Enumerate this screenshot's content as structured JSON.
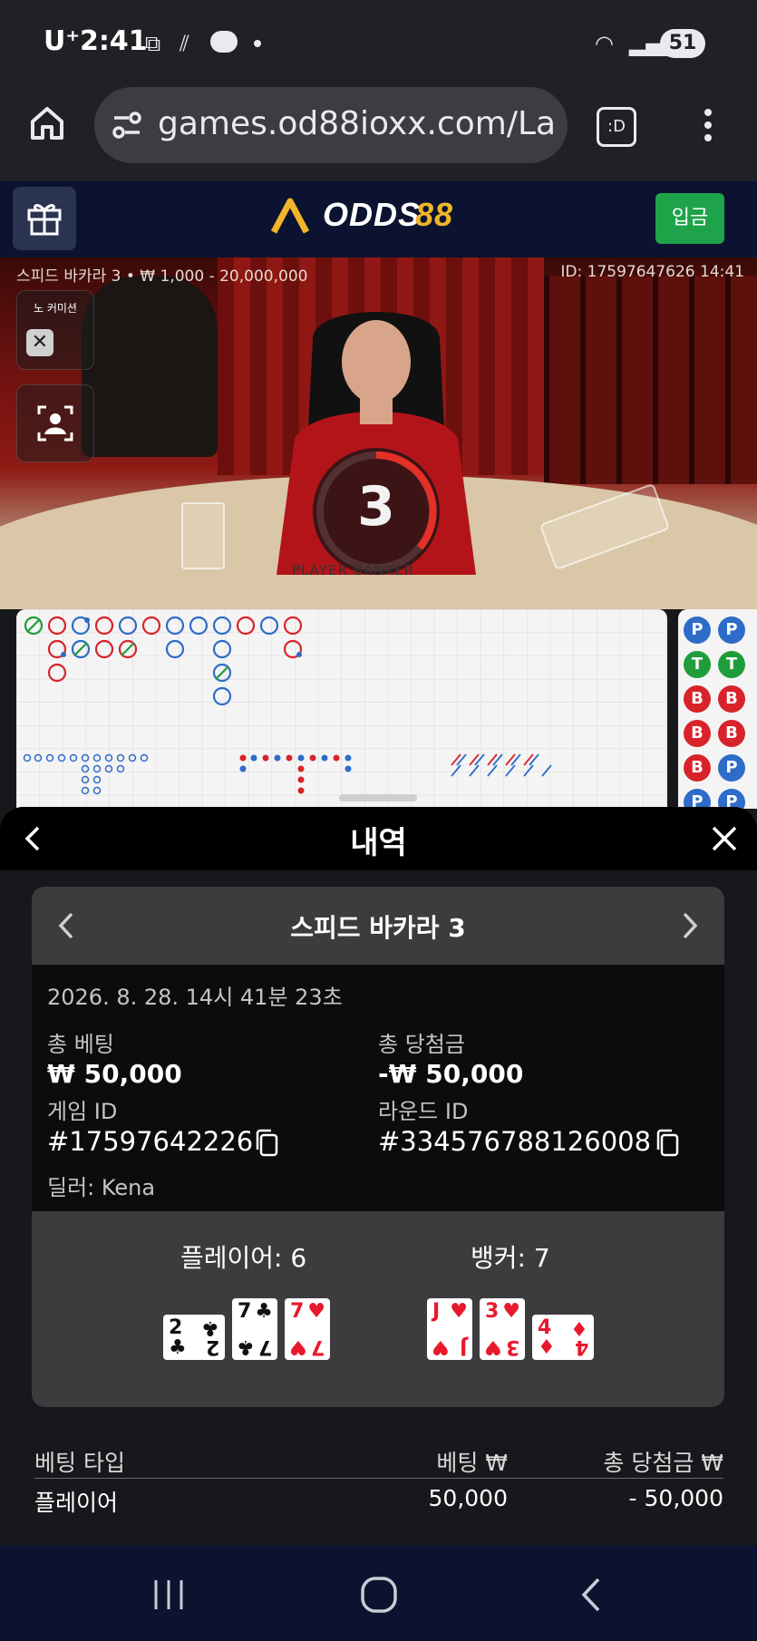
{
  "status_bar": {
    "carrier": "U⁺",
    "time": "2:41",
    "battery": "51"
  },
  "browser": {
    "url": "games.od88ioxx.com/Launc"
  },
  "site_header": {
    "logo_prefix": "ODDS",
    "logo_suffix": "88",
    "deposit_label": "입금"
  },
  "live_table": {
    "table_info": "스피드 바카라 3 • ₩ 1,000 - 20,000,000",
    "id_time": "ID: 17597647626 14:41",
    "no_commission_label": "노 커미션",
    "countdown": "3",
    "table_label": "PLAYER BANKER"
  },
  "roadmap_side": {
    "cells": [
      "P",
      "P",
      "T",
      "T",
      "B",
      "B",
      "B",
      "B",
      "B",
      "P",
      "P",
      "P"
    ]
  },
  "history_sheet": {
    "title": "내역",
    "game_name": "스피드 바카라 3",
    "datetime": "2026. 8. 28. 14시 41분 23초",
    "total_bet_label": "총 베팅",
    "total_bet_value": "₩ 50,000",
    "total_win_label": "총 당첨금",
    "total_win_value": "-₩ 50,000",
    "game_id_label": "게임 ID",
    "game_id_value": "#17597642226",
    "round_id_label": "라운드 ID",
    "round_id_value": "#334576788126008",
    "dealer": "딜러: Kena",
    "player_label": "플레이어: 6",
    "banker_label": "뱅커: 7",
    "player_cards": [
      {
        "rank": "2",
        "suit": "♣",
        "color": "black",
        "rotated": true
      },
      {
        "rank": "7",
        "suit": "♣",
        "color": "black",
        "rotated": false
      },
      {
        "rank": "7",
        "suit": "♥",
        "color": "red",
        "rotated": false
      }
    ],
    "banker_cards": [
      {
        "rank": "J",
        "suit": "♥",
        "color": "red",
        "rotated": false
      },
      {
        "rank": "3",
        "suit": "♥",
        "color": "red",
        "rotated": false
      },
      {
        "rank": "4",
        "suit": "♦",
        "color": "red",
        "rotated": true
      }
    ]
  },
  "bet_table": {
    "headers": [
      "베팅 타입",
      "베팅 ₩",
      "총 당첨금 ₩"
    ],
    "rows": [
      [
        "플레이어",
        "50,000",
        "- 50,000"
      ]
    ]
  }
}
